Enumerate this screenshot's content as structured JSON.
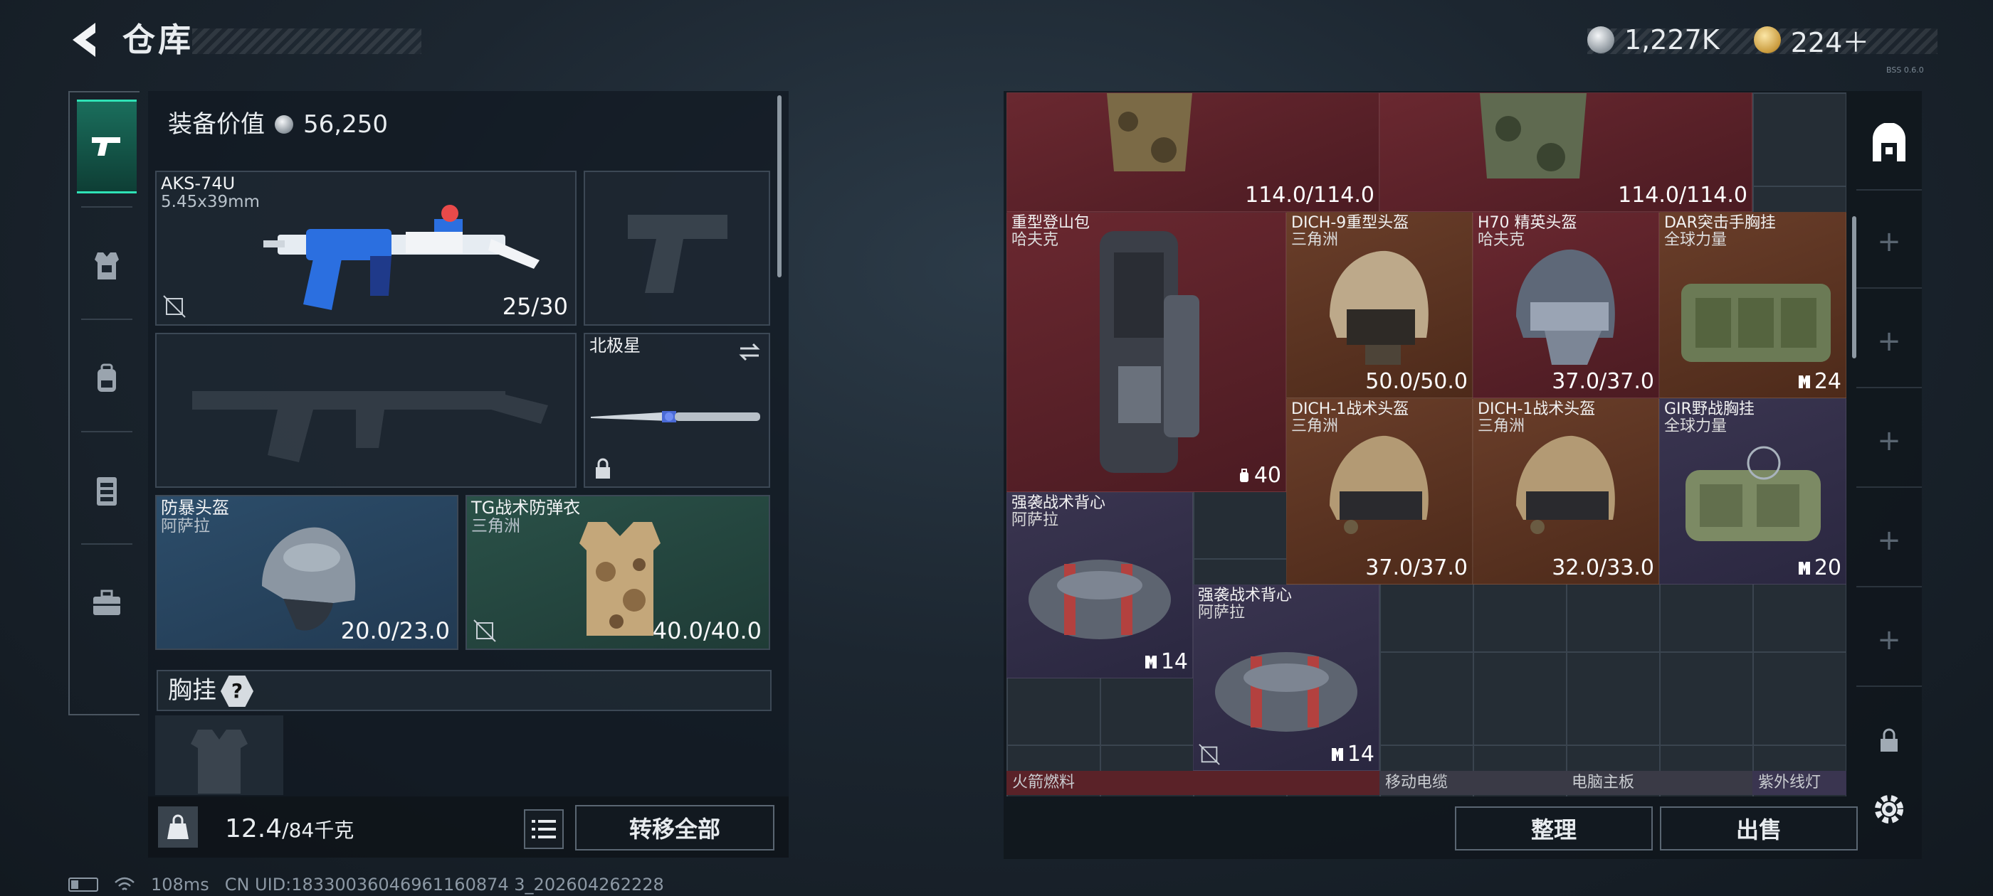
{
  "header": {
    "title": "仓库",
    "currency_a": "1,227K",
    "currency_b": "224＋",
    "build_tag": "BSS 0.6.0"
  },
  "left_nav": {
    "items": [
      {
        "id": "weapons",
        "icon": "pistol-icon",
        "active": true
      },
      {
        "id": "armor",
        "icon": "armor-icon",
        "active": false
      },
      {
        "id": "backpack",
        "icon": "backpack-icon",
        "active": false
      },
      {
        "id": "vest",
        "icon": "chest-rig-icon",
        "active": false
      },
      {
        "id": "case",
        "icon": "toolbox-icon",
        "active": false
      }
    ]
  },
  "equipment": {
    "value_label": "装备价值",
    "value": "56,250",
    "primary_weapon": {
      "name": "AKS-74U",
      "caliber": "5.45x39mm",
      "ammo": "25/30"
    },
    "melee": {
      "name": "北极星"
    },
    "helmet": {
      "name": "防暴头盔",
      "maker": "阿萨拉",
      "durability": "20.0/23.0"
    },
    "armor": {
      "name": "TG战术防弹衣",
      "maker": "三角洲",
      "durability": "40.0/40.0"
    },
    "chest_rig_label": "胸挂",
    "chest_rig_help": "?"
  },
  "weight": {
    "current": "12.4",
    "max": "/84千克"
  },
  "buttons": {
    "transfer_all": "转移全部",
    "sort": "整理",
    "sell": "出售"
  },
  "storage": {
    "items": [
      {
        "id": "top-armor-1",
        "durability": "114.0/114.0"
      },
      {
        "id": "top-armor-2",
        "durability": "114.0/114.0"
      },
      {
        "id": "heavy-backpack",
        "name": "重型登山包",
        "maker": "哈夫克",
        "count": "40"
      },
      {
        "id": "dich9-helmet",
        "name": "DICH-9重型头盔",
        "maker": "三角洲",
        "durability": "50.0/50.0"
      },
      {
        "id": "h70-helmet",
        "name": "H70 精英头盔",
        "maker": "哈夫克",
        "durability": "37.0/37.0"
      },
      {
        "id": "dar-rig",
        "name": "DAR突击手胸挂",
        "maker": "全球力量",
        "count": "24"
      },
      {
        "id": "dich1-helmet-a",
        "name": "DICH-1战术头盔",
        "maker": "三角洲",
        "durability": "37.0/37.0"
      },
      {
        "id": "dich1-helmet-b",
        "name": "DICH-1战术头盔",
        "maker": "三角洲",
        "durability": "32.0/33.0"
      },
      {
        "id": "gir-rig",
        "name": "GIR野战胸挂",
        "maker": "全球力量",
        "count": "20"
      },
      {
        "id": "assault-pack-a",
        "name": "强袭战术背心",
        "maker": "阿萨拉",
        "count": "14"
      },
      {
        "id": "assault-pack-b",
        "name": "强袭战术背心",
        "maker": "阿萨拉",
        "count": "14"
      }
    ],
    "bottom_row": [
      "火箭燃料",
      "移动电缆",
      "电脑主板",
      "紫外线灯"
    ]
  },
  "status": {
    "ping": "108ms",
    "uid": "CN UID:18330036046961160874 3_202604262228"
  },
  "colors": {
    "accent": "#2fe2b6",
    "rare_red": "#6a2830",
    "rare_orange": "#6a3e2a",
    "rare_purple": "#3a3550"
  }
}
